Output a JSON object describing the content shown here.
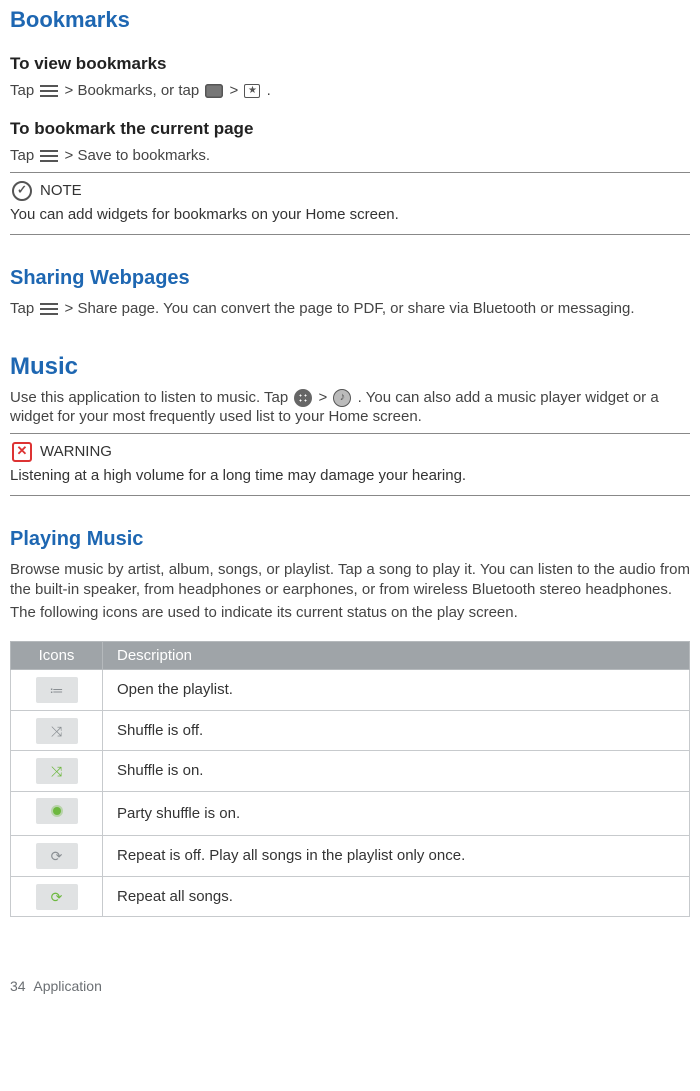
{
  "bookmarks": {
    "heading": "Bookmarks",
    "view_sub": "To view  bookmarks",
    "view_pre": "Tap ",
    "view_mid1": "  > Bookmarks, or tap ",
    "view_mid2": "> ",
    "view_end": ".",
    "save_sub": "To bookmark the current  page",
    "save_pre": "Tap ",
    "save_end": " > Save to bookmarks."
  },
  "note": {
    "label": "NOTE",
    "text": "You can add widgets for bookmarks on your Home  screen."
  },
  "sharing": {
    "heading": "Sharing Webpages",
    "text_pre": "Tap ",
    "text_end": " > Share page. You can convert the page to PDF, or share via Bluetooth or messaging."
  },
  "music": {
    "heading": "Music",
    "intro_pre": "Use this application to listen to music. Tap ",
    "intro_mid": "> ",
    "intro_end": ". You can also add a music player widget or a widget for your most frequently used list to your Home   screen."
  },
  "warning": {
    "label": "WARNING",
    "text": "Listening at a high volume for a long time may damage your  hearing."
  },
  "playing": {
    "heading": "Playing Music",
    "para1": "Browse music by artist, album, songs, or playlist. Tap  a song to play it. You  can listen to the audio from the built-in speaker, from headphones or earphones, or from wireless Bluetooth stereo  headphones.",
    "para2": "The following icons are used to indicate its current status on the play  screen."
  },
  "table": {
    "header_icons": "Icons",
    "header_desc": "Description",
    "rows": [
      {
        "glyph": "≔",
        "cls": "",
        "desc": "Open the playlist."
      },
      {
        "glyph": "⤨",
        "cls": "",
        "desc": "Shuffle is off."
      },
      {
        "glyph": "⤨",
        "cls": "on",
        "desc": "Shuffle is on."
      },
      {
        "glyph": "",
        "cls": "party",
        "desc": "Party shuffle is on."
      },
      {
        "glyph": "⟳",
        "cls": "",
        "desc": "Repeat is off. Play all songs in the playlist only  once."
      },
      {
        "glyph": "⟳",
        "cls": "on",
        "desc": "Repeat all songs."
      }
    ]
  },
  "footer": {
    "page": "34",
    "section": "Application"
  }
}
